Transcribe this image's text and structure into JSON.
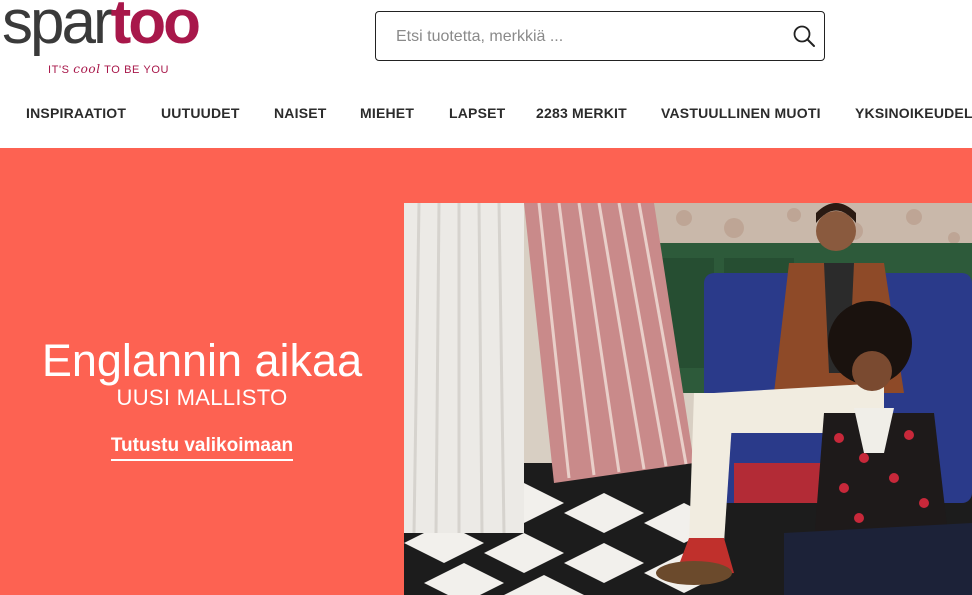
{
  "logo": {
    "part1": "spar",
    "part2": "too",
    "tag_before": "IT'S ",
    "tag_cool": "cool",
    "tag_after": " TO BE YOU"
  },
  "search": {
    "placeholder": "Etsi tuotetta, merkkiä ...",
    "value": "",
    "icon": "search-icon"
  },
  "nav": {
    "items": [
      {
        "label": "INSPIRAATIOT"
      },
      {
        "label": "UUTUUDET"
      },
      {
        "label": "NAISET"
      },
      {
        "label": "MIEHET"
      },
      {
        "label": "LAPSET"
      },
      {
        "label": "2283 MERKIT"
      },
      {
        "label": "VASTUULLINEN MUOTI"
      },
      {
        "label": "YKSINOIKEUDELL"
      }
    ]
  },
  "banner": {
    "title": "Englannin aikaa",
    "subtitle": "UUSI MALLISTO",
    "cta": "Tutustu valikoimaan"
  },
  "colors": {
    "brand": "#a8174a",
    "banner_bg": "#fd6252",
    "text_dark": "#2b2b2b"
  }
}
